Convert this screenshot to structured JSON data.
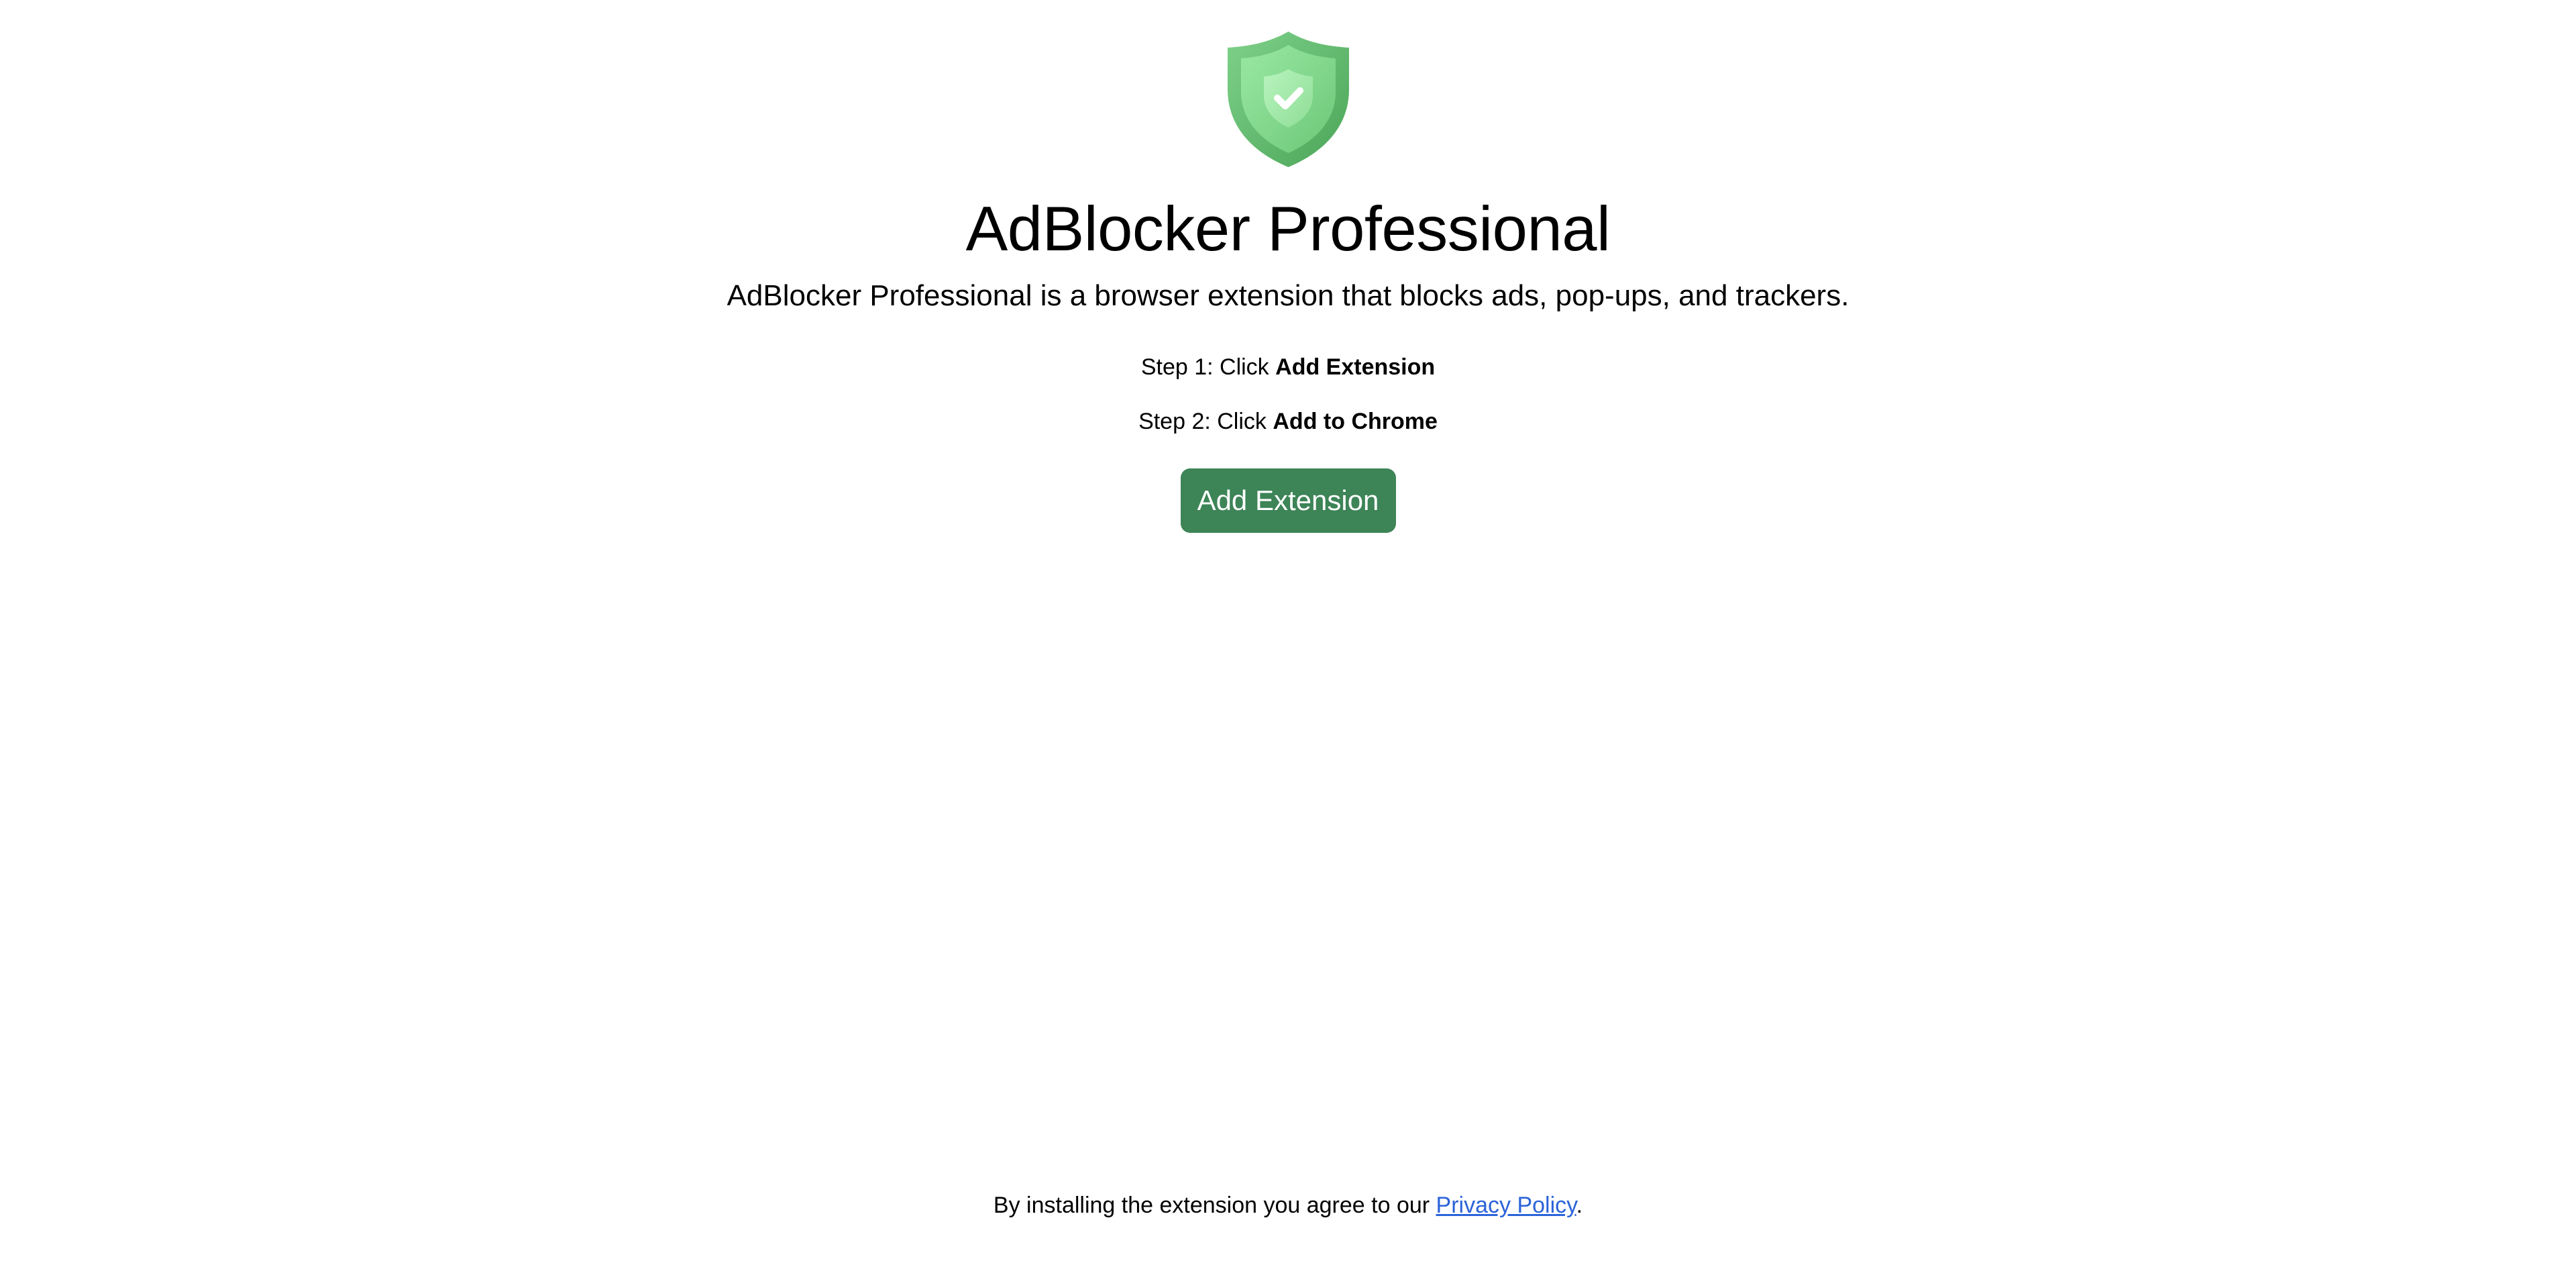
{
  "header": {
    "logo_icon": "shield-check-icon",
    "title": "AdBlocker Professional",
    "tagline": "AdBlocker Professional is a browser extension that blocks ads, pop-ups, and trackers."
  },
  "steps": [
    {
      "prefix": "Step 1: Click ",
      "action": "Add Extension"
    },
    {
      "prefix": "Step 2: Click ",
      "action": "Add to Chrome"
    }
  ],
  "cta": {
    "label": "Add Extension",
    "color": "#3d8457"
  },
  "footer": {
    "text_before": "By installing the extension you agree to our ",
    "link_label": "Privacy Policy",
    "text_after": ".",
    "link_color": "#2b63d9"
  },
  "colors": {
    "shield_outer": "#5fb56a",
    "shield_inner": "#8fdc97"
  }
}
